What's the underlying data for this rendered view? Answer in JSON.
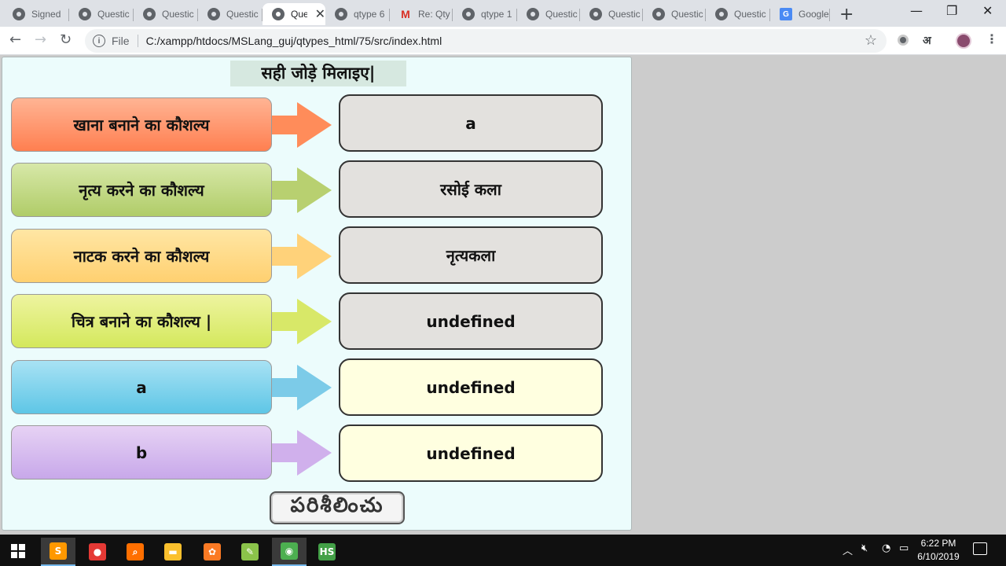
{
  "browser": {
    "tabs": [
      {
        "title": "Signed",
        "icon": "globe-icon"
      },
      {
        "title": "Questic",
        "icon": "globe-icon"
      },
      {
        "title": "Questic",
        "icon": "globe-icon"
      },
      {
        "title": "Questic",
        "icon": "globe-icon"
      },
      {
        "title": "Que",
        "icon": "globe-icon",
        "active": true,
        "close": "✕"
      },
      {
        "title": "qtype 6",
        "icon": "globe-icon"
      },
      {
        "title": "Re: Qty",
        "icon": "gmail-icon"
      },
      {
        "title": "qtype 1",
        "icon": "globe-icon"
      },
      {
        "title": "Questic",
        "icon": "globe-icon"
      },
      {
        "title": "Questic",
        "icon": "globe-icon"
      },
      {
        "title": "Questic",
        "icon": "globe-icon"
      },
      {
        "title": "Questic",
        "icon": "globe-icon"
      },
      {
        "title": "Google",
        "icon": "google-translate-icon"
      }
    ],
    "new_tab": "+",
    "window_controls": {
      "minimize": "—",
      "restore": "❐",
      "close": "✕"
    },
    "nav": {
      "back": "←",
      "forward": "→",
      "reload": "↻"
    },
    "address": {
      "scheme_label": "File",
      "url": "C:/xampp/htdocs/MSLang_guj/qtypes_html/75/src/index.html"
    },
    "toolbar_icons": {
      "star": "☆",
      "lang": "अ",
      "menu": "⋮"
    }
  },
  "quiz": {
    "title": "सही जोड़े मिलाइए|",
    "rows": [
      {
        "left": "खाना बनाने का कौशल्य",
        "right": "a",
        "left_color": "#ff7f50",
        "right_style": "grey"
      },
      {
        "left": "नृत्य करने का कौशल्य",
        "right": "रसोई कला",
        "left_color": "#b0cc68",
        "right_style": "grey"
      },
      {
        "left": "नाटक करने का कौशल्य",
        "right": "नृत्यकला",
        "left_color": "#ffd070",
        "right_style": "grey"
      },
      {
        "left": "चित्र बनाने का कौशल्य |",
        "right": "undefined",
        "left_color": "#d4e85c",
        "right_style": "grey"
      },
      {
        "left": "a",
        "right": "undefined",
        "left_color": "#5ec6e6",
        "right_style": "yellow"
      },
      {
        "left": "b",
        "right": "undefined",
        "left_color": "#c8a8ea",
        "right_style": "yellow"
      }
    ],
    "arrow_colors": [
      "#ff8c5a",
      "#b8d070",
      "#ffd27a",
      "#d8e868",
      "#7ccbe8",
      "#d0b0ec"
    ],
    "check_button": "పరిశీలించు"
  },
  "taskbar": {
    "apps": [
      {
        "name": "sublime-text-icon",
        "active": true,
        "color": "#ff9800",
        "glyph": "S"
      },
      {
        "name": "fruit-app-icon",
        "color": "#e53935",
        "glyph": "●"
      },
      {
        "name": "search-magnifier-icon",
        "color": "#ff6f00",
        "glyph": "⌕"
      },
      {
        "name": "file-explorer-icon",
        "color": "#fbc02d",
        "glyph": "▬"
      },
      {
        "name": "xampp-icon",
        "color": "#fb7a24",
        "glyph": "✿"
      },
      {
        "name": "notepad-icon",
        "color": "#8bc34a",
        "glyph": "✎"
      },
      {
        "name": "chrome-icon",
        "active": true,
        "color": "#4caf50",
        "glyph": "◉"
      },
      {
        "name": "hs-app-icon",
        "color": "#43a047",
        "glyph": "HS"
      }
    ],
    "time": "6:22 PM",
    "date": "6/10/2019"
  }
}
